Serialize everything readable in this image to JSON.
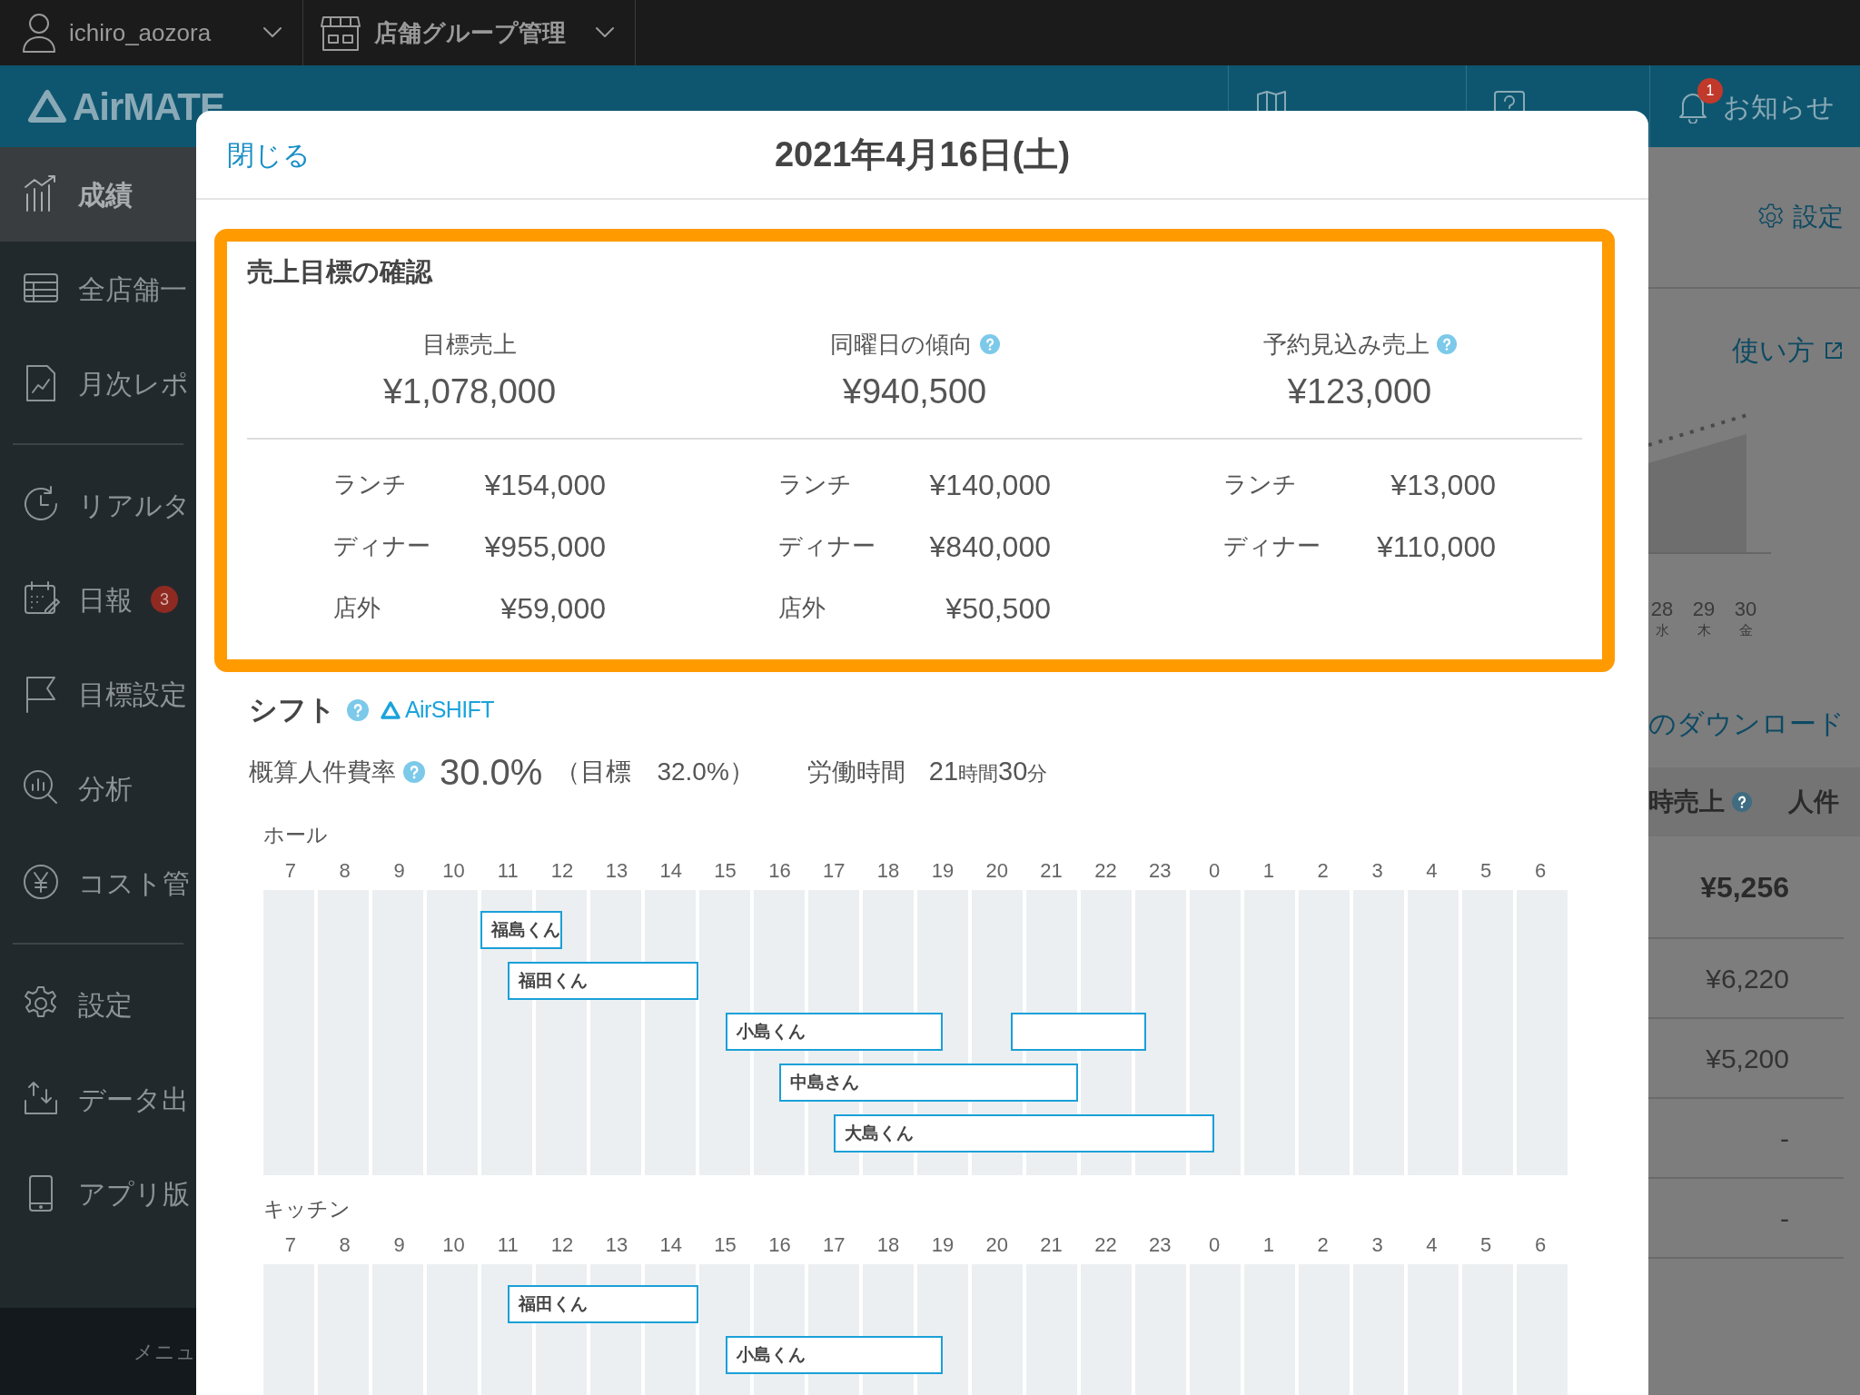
{
  "top_bar": {
    "user": "ichiro_aozora",
    "store_group": "店舗グループ管理"
  },
  "header": {
    "logo": "AirMATE",
    "links": [
      {
        "kind": "guide"
      },
      {
        "kind": "help"
      },
      {
        "label": "お知らせ",
        "kind": "bell",
        "badge": "1"
      }
    ]
  },
  "sidebar": {
    "groups": [
      [
        {
          "label": "成績",
          "selected": true
        },
        {
          "label": "全店舗一",
          "selected": false
        },
        {
          "label": "月次レポ",
          "selected": false
        }
      ],
      [
        {
          "label": "リアルタ",
          "selected": false
        },
        {
          "label": "日報",
          "selected": false,
          "badge": "3"
        },
        {
          "label": "目標設定",
          "selected": false
        },
        {
          "label": "分析",
          "selected": false
        },
        {
          "label": "コスト管",
          "selected": false
        }
      ],
      [
        {
          "label": "設定",
          "selected": false
        },
        {
          "label": "データ出",
          "selected": false
        },
        {
          "label": "アプリ版",
          "selected": false
        }
      ]
    ],
    "footer": "メニュ"
  },
  "background": {
    "settings": "設定",
    "howto": "使い方",
    "chart_days": [
      {
        "day": "28",
        "weekday": "水"
      },
      {
        "day": "29",
        "weekday": "木"
      },
      {
        "day": "30",
        "weekday": "金"
      }
    ],
    "download": "のダウンロード",
    "table": {
      "columns": [
        {
          "label": "時売上",
          "help": true
        },
        {
          "label": "人件",
          "help": false
        }
      ],
      "rows": [
        {
          "value": "¥5,256",
          "kind": "total"
        },
        {
          "value": "¥6,220",
          "kind": "day"
        },
        {
          "value": "¥5,200",
          "kind": "day"
        },
        {
          "value": "-",
          "kind": "day"
        },
        {
          "value": "-",
          "kind": "day"
        }
      ]
    }
  },
  "modal": {
    "close": "閉じる",
    "title": "2021年4月16日(土)",
    "targets": {
      "title": "売上目標の確認",
      "columns": [
        {
          "label": "目標売上",
          "help": false,
          "total": "¥1,078,000",
          "rows": [
            {
              "label": "ランチ",
              "value": "¥154,000"
            },
            {
              "label": "ディナー",
              "value": "¥955,000"
            },
            {
              "label": "店外",
              "value": "¥59,000"
            }
          ]
        },
        {
          "label": "同曜日の傾向",
          "help": true,
          "total": "¥940,500",
          "rows": [
            {
              "label": "ランチ",
              "value": "¥140,000"
            },
            {
              "label": "ディナー",
              "value": "¥840,000"
            },
            {
              "label": "店外",
              "value": "¥50,500"
            }
          ]
        },
        {
          "label": "予約見込み売上",
          "help": true,
          "total": "¥123,000",
          "rows": [
            {
              "label": "ランチ",
              "value": "¥13,000"
            },
            {
              "label": "ディナー",
              "value": "¥110,000"
            }
          ]
        }
      ]
    },
    "shift": {
      "title": "シフト",
      "brand": "AirSHIFT",
      "cost_label": "概算人件費率",
      "cost": "30.0%",
      "cost_target": "（目標　32.0%）",
      "hours_label": "労働時間",
      "hours_value": [
        {
          "text": "21",
          "kind": "number"
        },
        {
          "text": "時間",
          "kind": "unit"
        },
        {
          "text": "30",
          "kind": "number"
        },
        {
          "text": "分",
          "kind": "unit"
        }
      ],
      "sections": [
        {
          "name": "ホール",
          "hours": [
            "7",
            "8",
            "9",
            "10",
            "11",
            "12",
            "13",
            "14",
            "15",
            "16",
            "17",
            "18",
            "19",
            "20",
            "21",
            "22",
            "23",
            "0",
            "1",
            "2",
            "3",
            "4",
            "5",
            "6"
          ],
          "shifts": [
            {
              "kind": "named",
              "name": "福島くん"
            },
            {
              "kind": "named",
              "name": "福田くん"
            },
            {
              "kind": "named",
              "name": "小島くん"
            },
            {
              "kind": "unnamed"
            },
            {
              "kind": "named",
              "name": "中島さん"
            },
            {
              "kind": "named",
              "name": "大島くん"
            }
          ]
        },
        {
          "name": "キッチン",
          "hours": [
            "7",
            "8",
            "9",
            "10",
            "11",
            "12",
            "13",
            "14",
            "15",
            "16",
            "17",
            "18",
            "19",
            "20",
            "21",
            "22",
            "23",
            "0",
            "1",
            "2",
            "3",
            "4",
            "5",
            "6"
          ],
          "shifts": [
            {
              "kind": "named",
              "name": "福田くん"
            },
            {
              "kind": "named",
              "name": "小島くん"
            }
          ]
        }
      ]
    }
  }
}
